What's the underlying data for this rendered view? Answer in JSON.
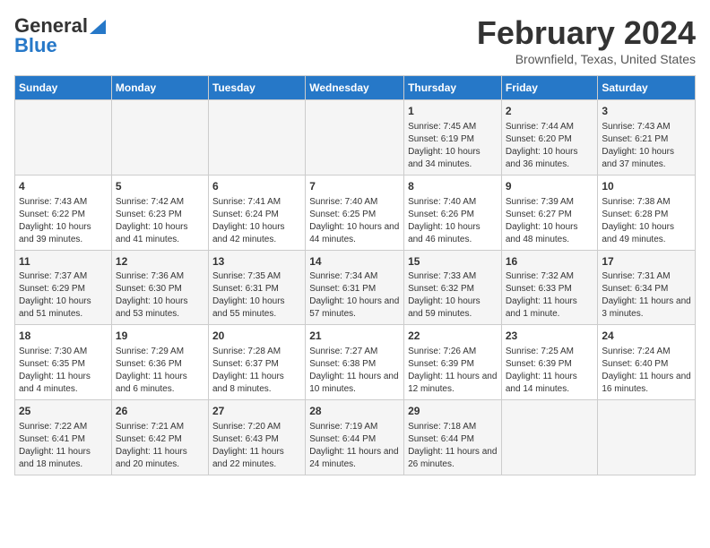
{
  "header": {
    "logo_line1": "General",
    "logo_line2": "Blue",
    "month": "February 2024",
    "location": "Brownfield, Texas, United States"
  },
  "weekdays": [
    "Sunday",
    "Monday",
    "Tuesday",
    "Wednesday",
    "Thursday",
    "Friday",
    "Saturday"
  ],
  "weeks": [
    [
      {
        "day": "",
        "data": ""
      },
      {
        "day": "",
        "data": ""
      },
      {
        "day": "",
        "data": ""
      },
      {
        "day": "",
        "data": ""
      },
      {
        "day": "1",
        "data": "Sunrise: 7:45 AM\nSunset: 6:19 PM\nDaylight: 10 hours and 34 minutes."
      },
      {
        "day": "2",
        "data": "Sunrise: 7:44 AM\nSunset: 6:20 PM\nDaylight: 10 hours and 36 minutes."
      },
      {
        "day": "3",
        "data": "Sunrise: 7:43 AM\nSunset: 6:21 PM\nDaylight: 10 hours and 37 minutes."
      }
    ],
    [
      {
        "day": "4",
        "data": "Sunrise: 7:43 AM\nSunset: 6:22 PM\nDaylight: 10 hours and 39 minutes."
      },
      {
        "day": "5",
        "data": "Sunrise: 7:42 AM\nSunset: 6:23 PM\nDaylight: 10 hours and 41 minutes."
      },
      {
        "day": "6",
        "data": "Sunrise: 7:41 AM\nSunset: 6:24 PM\nDaylight: 10 hours and 42 minutes."
      },
      {
        "day": "7",
        "data": "Sunrise: 7:40 AM\nSunset: 6:25 PM\nDaylight: 10 hours and 44 minutes."
      },
      {
        "day": "8",
        "data": "Sunrise: 7:40 AM\nSunset: 6:26 PM\nDaylight: 10 hours and 46 minutes."
      },
      {
        "day": "9",
        "data": "Sunrise: 7:39 AM\nSunset: 6:27 PM\nDaylight: 10 hours and 48 minutes."
      },
      {
        "day": "10",
        "data": "Sunrise: 7:38 AM\nSunset: 6:28 PM\nDaylight: 10 hours and 49 minutes."
      }
    ],
    [
      {
        "day": "11",
        "data": "Sunrise: 7:37 AM\nSunset: 6:29 PM\nDaylight: 10 hours and 51 minutes."
      },
      {
        "day": "12",
        "data": "Sunrise: 7:36 AM\nSunset: 6:30 PM\nDaylight: 10 hours and 53 minutes."
      },
      {
        "day": "13",
        "data": "Sunrise: 7:35 AM\nSunset: 6:31 PM\nDaylight: 10 hours and 55 minutes."
      },
      {
        "day": "14",
        "data": "Sunrise: 7:34 AM\nSunset: 6:31 PM\nDaylight: 10 hours and 57 minutes."
      },
      {
        "day": "15",
        "data": "Sunrise: 7:33 AM\nSunset: 6:32 PM\nDaylight: 10 hours and 59 minutes."
      },
      {
        "day": "16",
        "data": "Sunrise: 7:32 AM\nSunset: 6:33 PM\nDaylight: 11 hours and 1 minute."
      },
      {
        "day": "17",
        "data": "Sunrise: 7:31 AM\nSunset: 6:34 PM\nDaylight: 11 hours and 3 minutes."
      }
    ],
    [
      {
        "day": "18",
        "data": "Sunrise: 7:30 AM\nSunset: 6:35 PM\nDaylight: 11 hours and 4 minutes."
      },
      {
        "day": "19",
        "data": "Sunrise: 7:29 AM\nSunset: 6:36 PM\nDaylight: 11 hours and 6 minutes."
      },
      {
        "day": "20",
        "data": "Sunrise: 7:28 AM\nSunset: 6:37 PM\nDaylight: 11 hours and 8 minutes."
      },
      {
        "day": "21",
        "data": "Sunrise: 7:27 AM\nSunset: 6:38 PM\nDaylight: 11 hours and 10 minutes."
      },
      {
        "day": "22",
        "data": "Sunrise: 7:26 AM\nSunset: 6:39 PM\nDaylight: 11 hours and 12 minutes."
      },
      {
        "day": "23",
        "data": "Sunrise: 7:25 AM\nSunset: 6:39 PM\nDaylight: 11 hours and 14 minutes."
      },
      {
        "day": "24",
        "data": "Sunrise: 7:24 AM\nSunset: 6:40 PM\nDaylight: 11 hours and 16 minutes."
      }
    ],
    [
      {
        "day": "25",
        "data": "Sunrise: 7:22 AM\nSunset: 6:41 PM\nDaylight: 11 hours and 18 minutes."
      },
      {
        "day": "26",
        "data": "Sunrise: 7:21 AM\nSunset: 6:42 PM\nDaylight: 11 hours and 20 minutes."
      },
      {
        "day": "27",
        "data": "Sunrise: 7:20 AM\nSunset: 6:43 PM\nDaylight: 11 hours and 22 minutes."
      },
      {
        "day": "28",
        "data": "Sunrise: 7:19 AM\nSunset: 6:44 PM\nDaylight: 11 hours and 24 minutes."
      },
      {
        "day": "29",
        "data": "Sunrise: 7:18 AM\nSunset: 6:44 PM\nDaylight: 11 hours and 26 minutes."
      },
      {
        "day": "",
        "data": ""
      },
      {
        "day": "",
        "data": ""
      }
    ]
  ]
}
